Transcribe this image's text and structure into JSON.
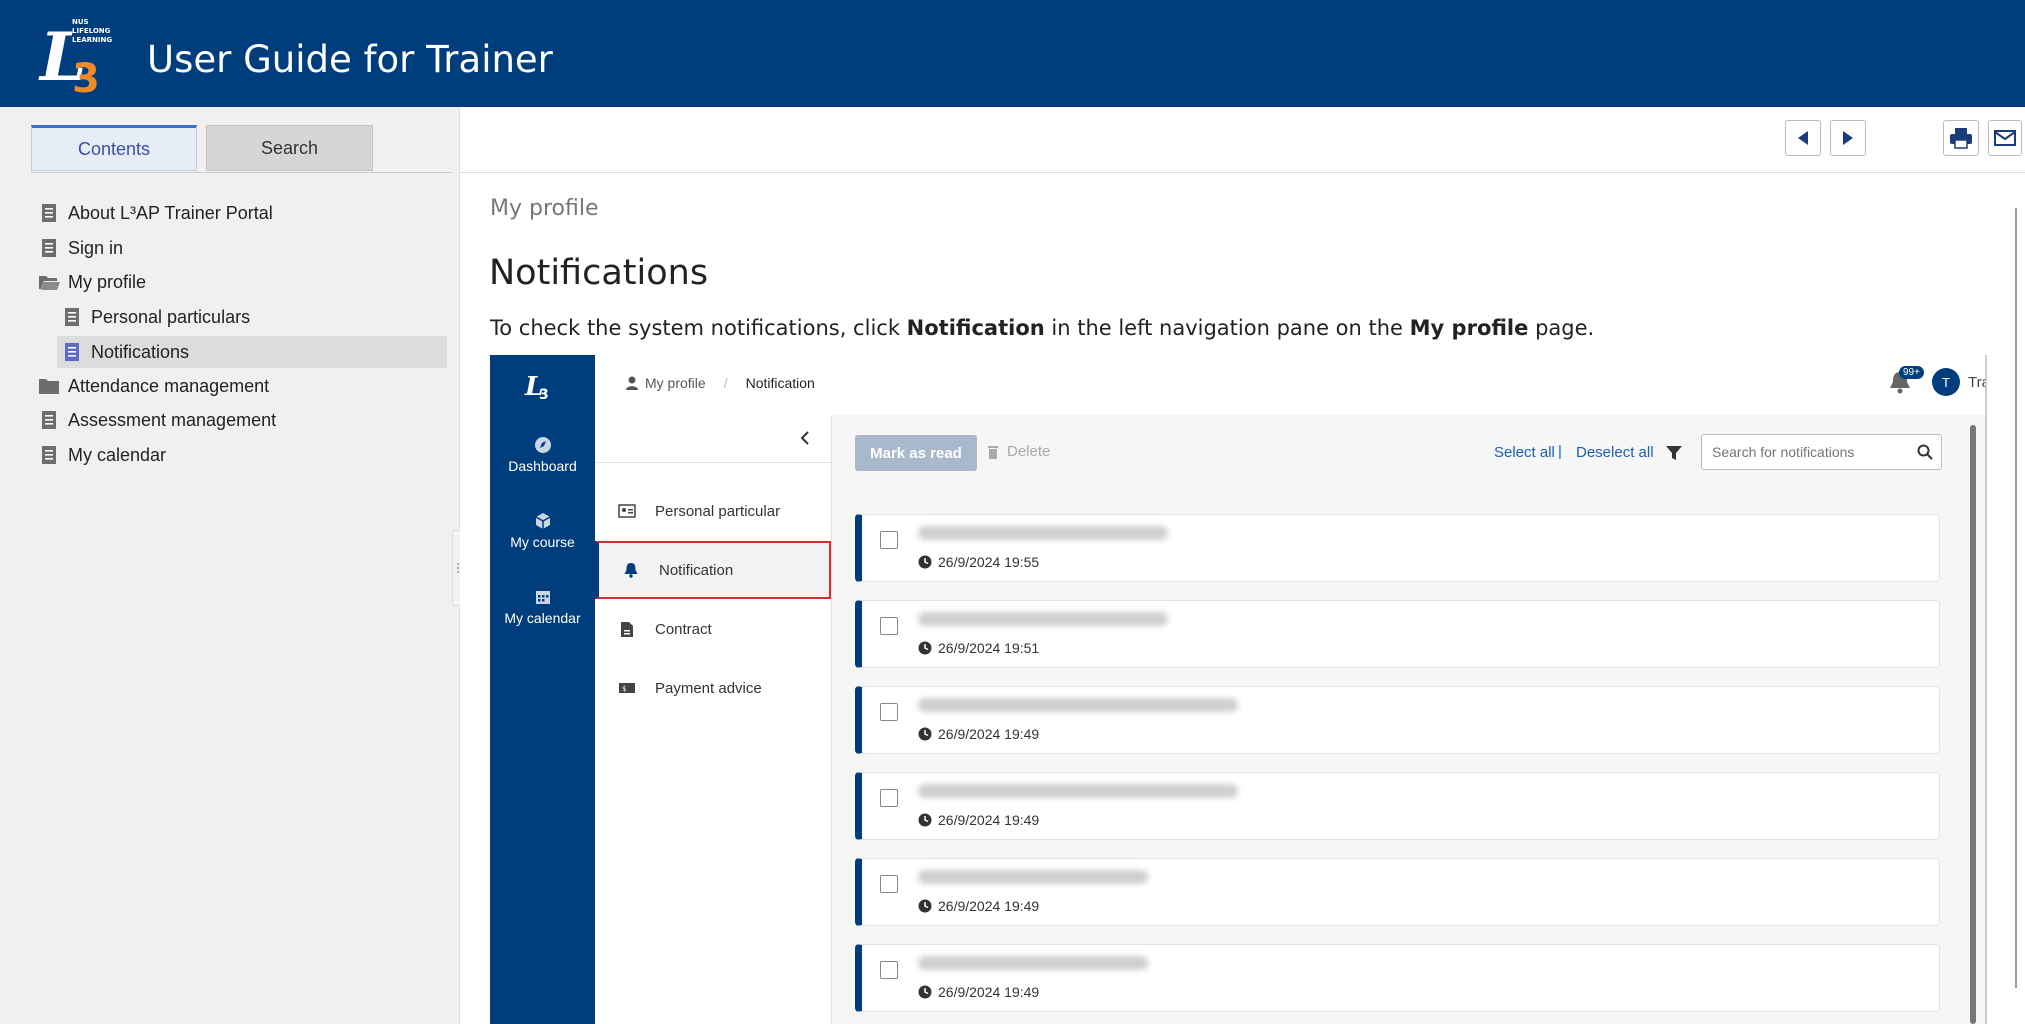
{
  "header": {
    "title": "User Guide for Trainer",
    "logo_text": "NUS LIFELONG LEARNING"
  },
  "sidebar": {
    "tabs": [
      "Contents",
      "Search"
    ],
    "items": [
      {
        "label": "About L³AP Trainer Portal",
        "icon": "page-icon"
      },
      {
        "label": "Sign in",
        "icon": "page-icon"
      },
      {
        "label": "My profile",
        "icon": "folder-open-icon"
      },
      {
        "label": "Personal particulars",
        "icon": "page-icon"
      },
      {
        "label": "Notifications",
        "icon": "page-icon"
      },
      {
        "label": "Attendance management",
        "icon": "folder-icon"
      },
      {
        "label": "Assessment management",
        "icon": "page-icon"
      },
      {
        "label": "My calendar",
        "icon": "page-icon"
      }
    ]
  },
  "main": {
    "breadcrumb": "My profile",
    "title": "Notifications",
    "intro_pre": "To check the system notifications, click ",
    "intro_bold1": "Notification",
    "intro_mid": " in the left navigation pane on the ",
    "intro_bold2": "My profile",
    "intro_post": " page."
  },
  "screenshot": {
    "nav": [
      {
        "label": "Dashboard",
        "icon": "compass-icon"
      },
      {
        "label": "My course",
        "icon": "cube-icon"
      },
      {
        "label": "My calendar",
        "icon": "calendar-icon"
      }
    ],
    "breadcrumb": [
      "My profile",
      "/",
      "Notification"
    ],
    "badge": "99+",
    "avatar_letter": "T",
    "user": "Trainer",
    "subnav": [
      {
        "label": "Personal particular",
        "icon": "id-card-icon"
      },
      {
        "label": "Notification",
        "icon": "bell-icon"
      },
      {
        "label": "Contract",
        "icon": "document-icon"
      },
      {
        "label": "Payment advice",
        "icon": "money-icon"
      }
    ],
    "toolbar": {
      "mark_read": "Mark as read",
      "delete": "Delete",
      "select_all": "Select all",
      "separator": "|",
      "deselect_all": "Deselect all",
      "search_placeholder": "Search for notifications"
    },
    "notifications": [
      {
        "time": "26/9/2024 19:55"
      },
      {
        "time": "26/9/2024 19:51"
      },
      {
        "time": "26/9/2024 19:49"
      },
      {
        "time": "26/9/2024 19:49"
      },
      {
        "time": "26/9/2024 19:49"
      },
      {
        "time": "26/9/2024 19:49"
      }
    ]
  },
  "colors": {
    "brand": "#003d7c",
    "accent_orange": "#f08a24",
    "highlight_red": "#d32f2f",
    "mark_read_btn": "#a9b9cc"
  }
}
